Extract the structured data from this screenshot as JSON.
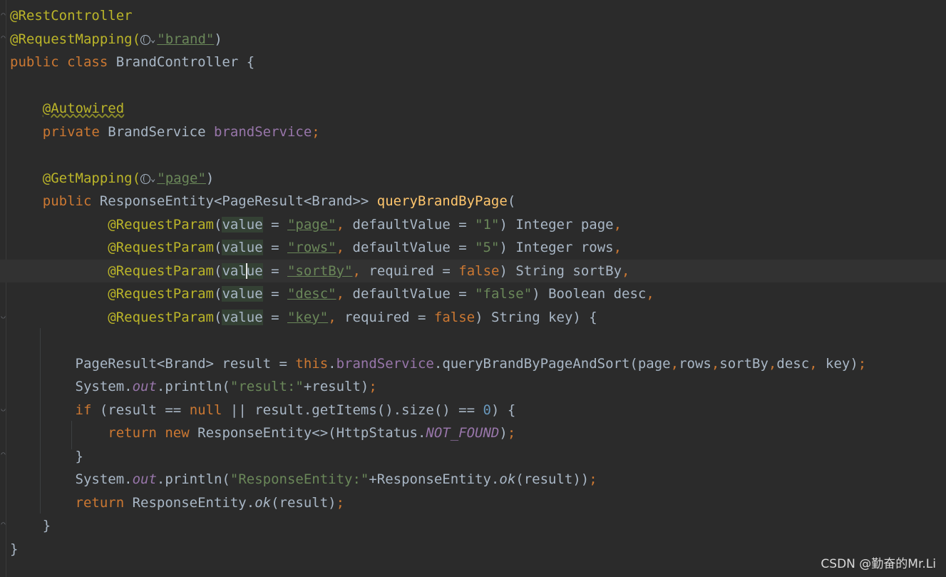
{
  "editor": {
    "lines": {
      "l1_ann": "@RestController",
      "l2_ann": "@RequestMapping(",
      "l2_str": "\"brand\"",
      "l2_close": ")",
      "l3_kw1": "public ",
      "l3_kw2": "class ",
      "l3_rest": "BrandController {",
      "l5_ann": "@Autowired",
      "l6_kw": "private ",
      "l6_type": "BrandService ",
      "l6_fld": "brandService",
      "l6_semi": ";",
      "l8_ann": "@GetMapping(",
      "l8_str": "\"page\"",
      "l8_close": ")",
      "l9_kw": "public ",
      "l9_type": "ResponseEntity<PageResult<Brand>> ",
      "l9_mth": "queryBrandByPage",
      "l9_paren": "(",
      "p1": {
        "ann": "@RequestParam",
        "open": "(",
        "value": "value",
        "eq": " = ",
        "str": "\"page\"",
        "comma": ", ",
        "rest1": "defaultValue = ",
        "str2": "\"1\"",
        "rest2": ") Integer page",
        "end": ","
      },
      "p2": {
        "ann": "@RequestParam",
        "open": "(",
        "value": "value",
        "eq": " = ",
        "str": "\"rows\"",
        "comma": ", ",
        "rest1": "defaultValue = ",
        "str2": "\"5\"",
        "rest2": ") Integer rows",
        "end": ","
      },
      "p3": {
        "ann": "@RequestParam",
        "open": "(",
        "value_a": "val",
        "value_b": "ue",
        "eq": " = ",
        "str": "\"sortBy\"",
        "comma": ", ",
        "rest1": "required = ",
        "kw": "false",
        "rest2": ") String sortBy",
        "end": ","
      },
      "p4": {
        "ann": "@RequestParam",
        "open": "(",
        "value": "value",
        "eq": " = ",
        "str": "\"desc\"",
        "comma": ", ",
        "rest1": "defaultValue = ",
        "str2": "\"false\"",
        "rest2": ") Boolean desc",
        "end": ","
      },
      "p5": {
        "ann": "@RequestParam",
        "open": "(",
        "value": "value",
        "eq": " = ",
        "str": "\"key\"",
        "comma": ", ",
        "rest1": "required = ",
        "kw": "false",
        "rest2": ") String key) {"
      },
      "l16_a": "PageResult<Brand> result = ",
      "l16_this": "this",
      "l16_dot": ".",
      "l16_fld": "brandService",
      "l16_b": ".queryBrandByPageAndSort(page",
      "l16_c1": ",",
      "l16_c": "rows",
      "l16_c2": ",",
      "l16_d": "sortBy",
      "l16_c3": ",",
      "l16_e": "desc",
      "l16_c4": ", ",
      "l16_f": "key)",
      "l16_semi": ";",
      "l17_a": "System.",
      "l17_out": "out",
      "l17_b": ".println(",
      "l17_str": "\"result:\"",
      "l17_c": "+result)",
      "l17_semi": ";",
      "l18_kw": "if ",
      "l18_a": "(result == ",
      "l18_null": "null",
      "l18_b": " || result.getItems().size() == ",
      "l18_num": "0",
      "l18_c": ") {",
      "l19_kw1": "return ",
      "l19_kw2": "new ",
      "l19_a": "ResponseEntity<>(HttpStatus.",
      "l19_const": "NOT_FOUND",
      "l19_b": ")",
      "l19_semi": ";",
      "l20": "}",
      "l21_a": "System.",
      "l21_out": "out",
      "l21_b": ".println(",
      "l21_str": "\"ResponseEntity:\"",
      "l21_c": "+ResponseEntity.",
      "l21_ok": "ok",
      "l21_d": "(result))",
      "l21_semi": ";",
      "l22_kw": "return ",
      "l22_a": "ResponseEntity.",
      "l22_ok": "ok",
      "l22_b": "(result)",
      "l22_semi": ";",
      "l23": "}",
      "l24": "}"
    }
  },
  "watermark": "CSDN @勤奋的Mr.Li",
  "icons": [
    "globe-icon",
    "chevron-down-icon",
    "fold-marker-icon"
  ],
  "colors": {
    "background": "#2b2b2b",
    "text": "#a9b7c6",
    "keyword": "#cc7832",
    "annotation": "#bbb529",
    "string": "#6a8759",
    "field": "#9876aa",
    "method": "#ffc66d",
    "number": "#6897bb"
  }
}
